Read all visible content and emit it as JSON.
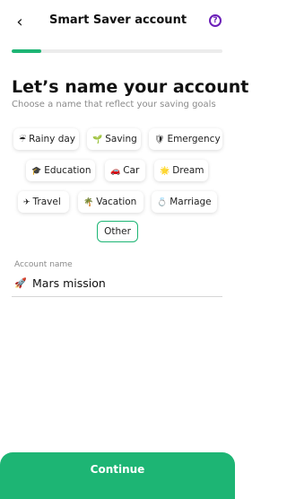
{
  "header": {
    "title": "Smart Saver account",
    "help_glyph": "?"
  },
  "progress": {
    "fraction": 0.14
  },
  "heading": "Let’s name your account",
  "subheading": "Choose a name that reflect your saving goals",
  "chips": [
    {
      "label": "Rainy day",
      "emoji": "☔",
      "icon": "umbrella-rain-icon"
    },
    {
      "label": "Saving",
      "emoji": "🌱",
      "icon": "sprout-icon"
    },
    {
      "label": "Emergency",
      "emoji": "🛡",
      "icon": "shield-icon"
    },
    {
      "label": "Education",
      "emoji": "🎓",
      "icon": "graduation-cap-icon"
    },
    {
      "label": "Car",
      "emoji": "🚗",
      "icon": "car-icon"
    },
    {
      "label": "Dream",
      "emoji": "🌟",
      "icon": "star-icon"
    },
    {
      "label": "Travel",
      "emoji": "✈",
      "icon": "airplane-icon"
    },
    {
      "label": "Vacation",
      "emoji": "🌴",
      "icon": "palm-tree-icon"
    },
    {
      "label": "Marriage",
      "emoji": "💍",
      "icon": "ring-icon"
    },
    {
      "label": "Other",
      "emoji": "",
      "icon": "",
      "selected": true
    }
  ],
  "account_name": {
    "label": "Account name",
    "value": "Mars mission",
    "emoji": "🚀",
    "icon": "rocket-icon"
  },
  "continue_label": "Continue",
  "colors": {
    "accent": "#1db574",
    "help": "#6b1fb8"
  }
}
